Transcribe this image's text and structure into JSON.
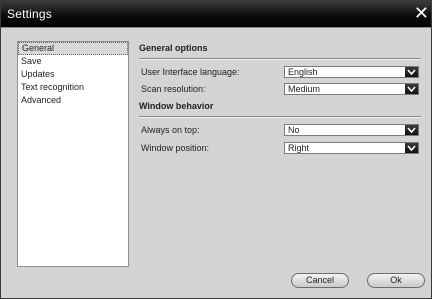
{
  "window": {
    "title": "Settings",
    "close_glyph": "✕"
  },
  "sidebar": {
    "items": [
      {
        "label": "General",
        "selected": true
      },
      {
        "label": "Save"
      },
      {
        "label": "Updates"
      },
      {
        "label": "Text recognition"
      },
      {
        "label": "Advanced"
      }
    ]
  },
  "general": {
    "heading": "General options",
    "language": {
      "label": "User Interface language:",
      "value": "English"
    },
    "resolution": {
      "label": "Scan resolution:",
      "value": "Medium"
    }
  },
  "window_behavior": {
    "heading": "Window behavior",
    "always_on_top": {
      "label": "Always on top:",
      "value": "No"
    },
    "position": {
      "label": "Window position:",
      "value": "Right"
    }
  },
  "buttons": {
    "cancel": "Cancel",
    "ok": "Ok"
  },
  "icons": {
    "close": "close-icon",
    "dropdown": "chevron-down-icon"
  }
}
